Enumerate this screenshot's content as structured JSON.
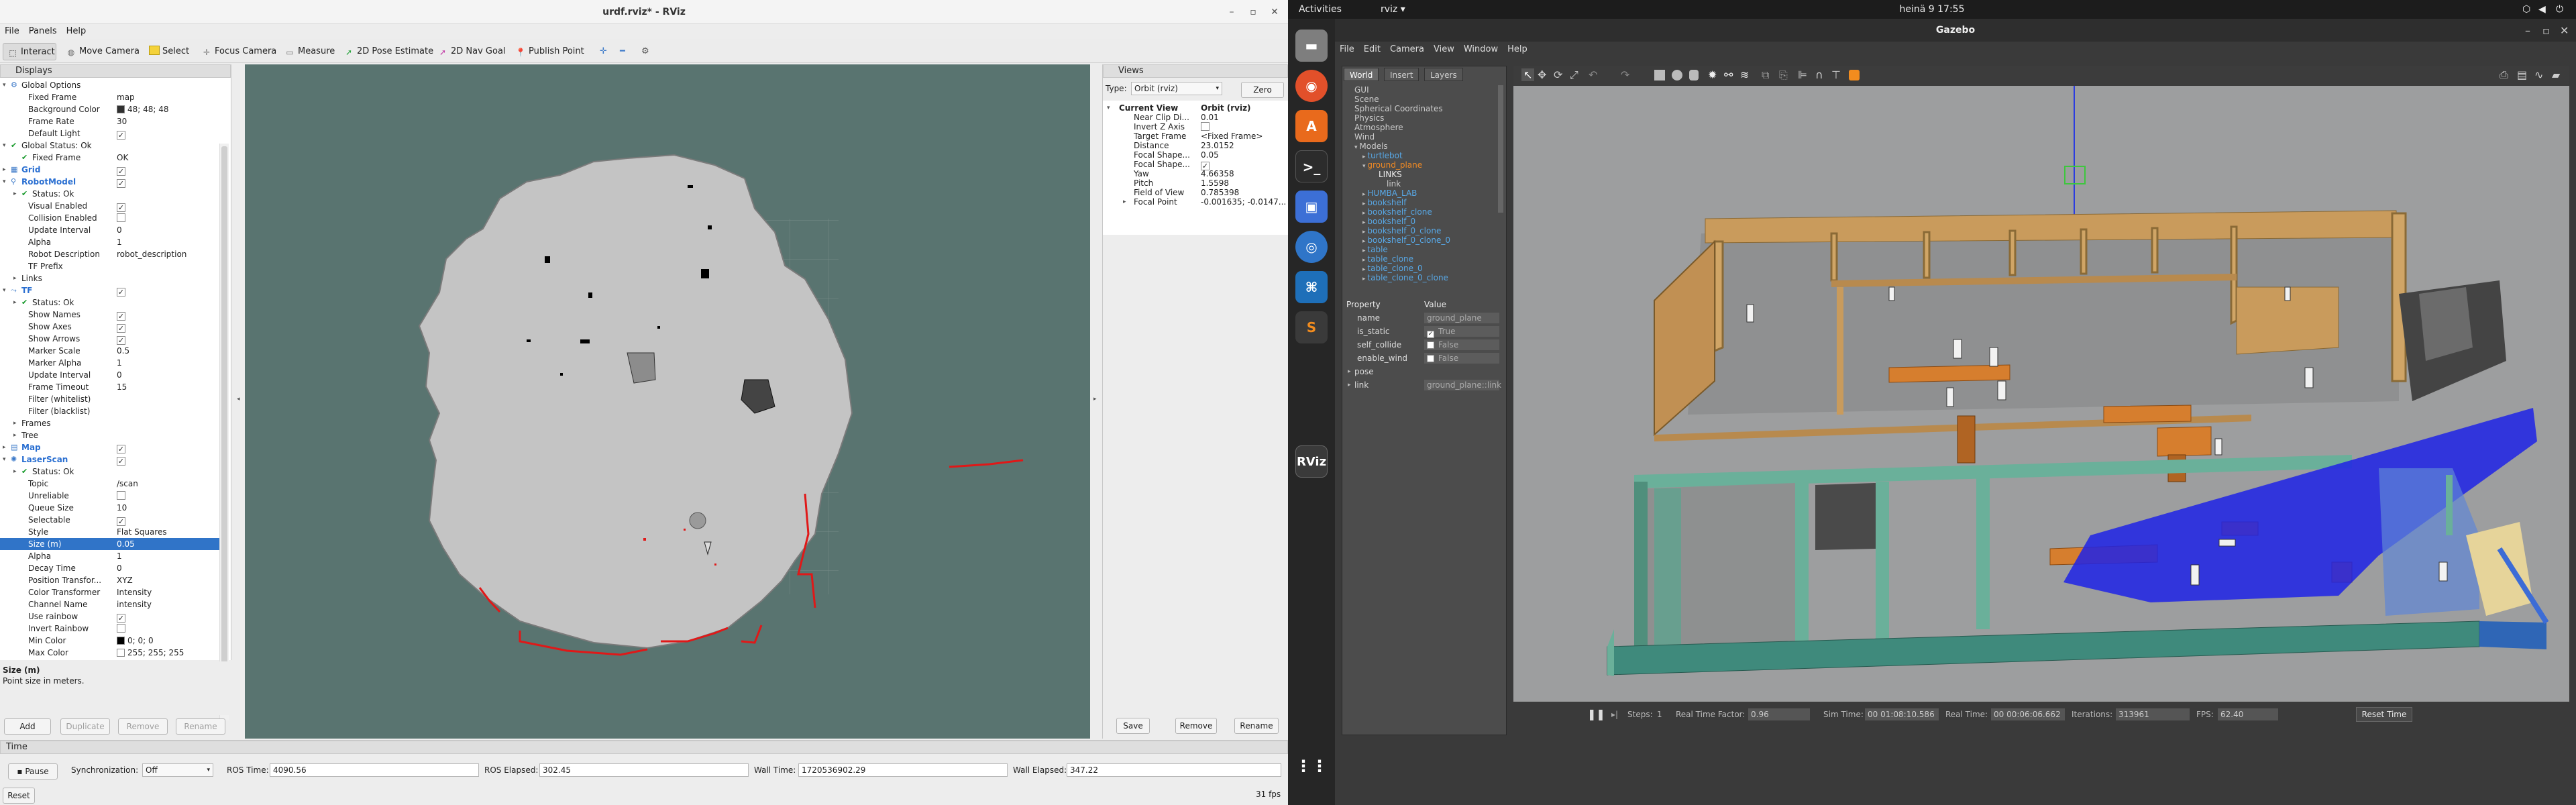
{
  "rviz": {
    "window_title": "urdf.rviz* - RViz",
    "menu": [
      "File",
      "Panels",
      "Help"
    ],
    "tools": [
      "Interact",
      "Move Camera",
      "Select",
      "Focus Camera",
      "Measure",
      "2D Pose Estimate",
      "2D Nav Goal",
      "Publish Point"
    ],
    "displays_title": "Displays",
    "display_rows": [
      {
        "label": "Global Options",
        "value": "",
        "indent": 1,
        "arrow": "▾",
        "icon": "globe",
        "kind": "group"
      },
      {
        "label": "Fixed Frame",
        "value": "map",
        "indent": 2
      },
      {
        "label": "Background Color",
        "value": "48; 48; 48",
        "indent": 2,
        "swatch": "#303030"
      },
      {
        "label": "Frame Rate",
        "value": "30",
        "indent": 2
      },
      {
        "label": "Default Light",
        "value": "",
        "indent": 2,
        "check": true
      },
      {
        "label": "Global Status: Ok",
        "value": "",
        "indent": 1,
        "arrow": "▾",
        "ok": true
      },
      {
        "label": "Fixed Frame",
        "value": "OK",
        "indent": 2,
        "ok": true
      },
      {
        "label": "Grid",
        "value": "",
        "indent": 1,
        "arrow": "▸",
        "blue": true,
        "check": true,
        "icon": "grid"
      },
      {
        "label": "RobotModel",
        "value": "",
        "indent": 1,
        "arrow": "▾",
        "blue": true,
        "check": true,
        "icon": "robot"
      },
      {
        "label": "Status: Ok",
        "value": "",
        "indent": 2,
        "arrow": "▸",
        "ok": true
      },
      {
        "label": "Visual Enabled",
        "value": "",
        "indent": 2,
        "check": true
      },
      {
        "label": "Collision Enabled",
        "value": "",
        "indent": 2,
        "check": false
      },
      {
        "label": "Update Interval",
        "value": "0",
        "indent": 2
      },
      {
        "label": "Alpha",
        "value": "1",
        "indent": 2
      },
      {
        "label": "Robot Description",
        "value": "robot_description",
        "indent": 2
      },
      {
        "label": "TF Prefix",
        "value": "",
        "indent": 2
      },
      {
        "label": "Links",
        "value": "",
        "indent": 2,
        "arrow": "▸"
      },
      {
        "label": "TF",
        "value": "",
        "indent": 1,
        "arrow": "▾",
        "blue": true,
        "check": true,
        "icon": "tf"
      },
      {
        "label": "Status: Ok",
        "value": "",
        "indent": 2,
        "arrow": "▸",
        "ok": true
      },
      {
        "label": "Show Names",
        "value": "",
        "indent": 2,
        "check": true
      },
      {
        "label": "Show Axes",
        "value": "",
        "indent": 2,
        "check": true
      },
      {
        "label": "Show Arrows",
        "value": "",
        "indent": 2,
        "check": true
      },
      {
        "label": "Marker Scale",
        "value": "0.5",
        "indent": 2
      },
      {
        "label": "Marker Alpha",
        "value": "1",
        "indent": 2
      },
      {
        "label": "Update Interval",
        "value": "0",
        "indent": 2
      },
      {
        "label": "Frame Timeout",
        "value": "15",
        "indent": 2
      },
      {
        "label": "Filter (whitelist)",
        "value": "",
        "indent": 2
      },
      {
        "label": "Filter (blacklist)",
        "value": "",
        "indent": 2
      },
      {
        "label": "Frames",
        "value": "",
        "indent": 2,
        "arrow": "▸"
      },
      {
        "label": "Tree",
        "value": "",
        "indent": 2,
        "arrow": "▸"
      },
      {
        "label": "Map",
        "value": "",
        "indent": 1,
        "arrow": "▸",
        "blue": true,
        "check": true,
        "icon": "map"
      },
      {
        "label": "LaserScan",
        "value": "",
        "indent": 1,
        "arrow": "▾",
        "blue": true,
        "check": true,
        "icon": "laser"
      },
      {
        "label": "Status: Ok",
        "value": "",
        "indent": 2,
        "arrow": "▸",
        "ok": true
      },
      {
        "label": "Topic",
        "value": "/scan",
        "indent": 2
      },
      {
        "label": "Unreliable",
        "value": "",
        "indent": 2,
        "check": false
      },
      {
        "label": "Queue Size",
        "value": "10",
        "indent": 2
      },
      {
        "label": "Selectable",
        "value": "",
        "indent": 2,
        "check": true
      },
      {
        "label": "Style",
        "value": "Flat Squares",
        "indent": 2
      },
      {
        "label": "Size (m)",
        "value": "0.05",
        "indent": 2,
        "selected": true
      },
      {
        "label": "Alpha",
        "value": "1",
        "indent": 2
      },
      {
        "label": "Decay Time",
        "value": "0",
        "indent": 2
      },
      {
        "label": "Position Transfor...",
        "value": "XYZ",
        "indent": 2
      },
      {
        "label": "Color Transformer",
        "value": "Intensity",
        "indent": 2
      },
      {
        "label": "Channel Name",
        "value": "intensity",
        "indent": 2
      },
      {
        "label": "Use rainbow",
        "value": "",
        "indent": 2,
        "check": true
      },
      {
        "label": "Invert Rainbow",
        "value": "",
        "indent": 2,
        "check": false
      },
      {
        "label": "Min Color",
        "value": "0; 0; 0",
        "indent": 2,
        "swatch": "#000000"
      },
      {
        "label": "Max Color",
        "value": "255; 255; 255",
        "indent": 2,
        "swatch": "#ffffff"
      }
    ],
    "desc_title": "Size (m)",
    "desc_text": "Point size in meters.",
    "display_buttons": [
      "Add",
      "Duplicate",
      "Remove",
      "Rename"
    ],
    "views_title": "Views",
    "views_type_label": "Type:",
    "views_type_value": "Orbit (rviz)",
    "views_zero": "Zero",
    "view_rows": [
      {
        "label": "Current View",
        "value": "Orbit (rviz)",
        "bold": true,
        "arrow": "▾"
      },
      {
        "label": "Near Clip Di...",
        "value": "0.01"
      },
      {
        "label": "Invert Z Axis",
        "value": "",
        "check": false
      },
      {
        "label": "Target Frame",
        "value": "<Fixed Frame>"
      },
      {
        "label": "Distance",
        "value": "23.0152"
      },
      {
        "label": "Focal Shape...",
        "value": "0.05"
      },
      {
        "label": "Focal Shape...",
        "value": "",
        "check": true
      },
      {
        "label": "Yaw",
        "value": "4.66358"
      },
      {
        "label": "Pitch",
        "value": "1.5598"
      },
      {
        "label": "Field of View",
        "value": "0.785398"
      },
      {
        "label": "Focal Point",
        "value": "-0.001635; -0.0147...",
        "arrow": "▸"
      }
    ],
    "views_buttons": [
      "Save",
      "Remove",
      "Rename"
    ],
    "time_title": "Time",
    "pause": "Pause",
    "sync_label": "Synchronization:",
    "sync_value": "Off",
    "ros_time_label": "ROS Time:",
    "ros_time": "4090.56",
    "ros_elapsed_label": "ROS Elapsed:",
    "ros_elapsed": "302.45",
    "wall_time_label": "Wall Time:",
    "wall_time": "1720536902.29",
    "wall_elapsed_label": "Wall Elapsed:",
    "wall_elapsed": "347.22",
    "reset": "Reset",
    "fps": "31 fps"
  },
  "ubuntu": {
    "activities": "Activities",
    "app_menu": "rviz ▾",
    "clock": "heinä 9  17:55",
    "dock": [
      "files-icon",
      "firefox-icon",
      "software-icon",
      "terminal-icon",
      "screenshot-icon",
      "update-icon",
      "vscode-icon",
      "sublime-icon",
      "rviz-icon"
    ]
  },
  "gazebo": {
    "title": "Gazebo",
    "menu": [
      "File",
      "Edit",
      "Camera",
      "View",
      "Window",
      "Help"
    ],
    "tabs": [
      "World",
      "Insert",
      "Layers"
    ],
    "tree": [
      {
        "t": "GUI",
        "i": 0
      },
      {
        "t": "Scene",
        "i": 0
      },
      {
        "t": "Spherical Coordinates",
        "i": 0
      },
      {
        "t": "Physics",
        "i": 0
      },
      {
        "t": "Atmosphere",
        "i": 0
      },
      {
        "t": "Wind",
        "i": 0
      },
      {
        "t": "Models",
        "i": 0,
        "a": "▾"
      },
      {
        "t": "turtlebot",
        "i": 1,
        "a": "▸",
        "model": true
      },
      {
        "t": "ground_plane",
        "i": 1,
        "a": "▾",
        "sel": true
      },
      {
        "t": "LINKS",
        "i": 3,
        "head": true
      },
      {
        "t": "link",
        "i": 4
      },
      {
        "t": "HUMBA_LAB",
        "i": 1,
        "a": "▸",
        "model": true
      },
      {
        "t": "bookshelf",
        "i": 1,
        "a": "▸",
        "model": true
      },
      {
        "t": "bookshelf_clone",
        "i": 1,
        "a": "▸",
        "model": true
      },
      {
        "t": "bookshelf_0",
        "i": 1,
        "a": "▸",
        "model": true
      },
      {
        "t": "bookshelf_0_clone",
        "i": 1,
        "a": "▸",
        "model": true
      },
      {
        "t": "bookshelf_0_clone_0",
        "i": 1,
        "a": "▸",
        "model": true
      },
      {
        "t": "table",
        "i": 1,
        "a": "▸",
        "model": true
      },
      {
        "t": "table_clone",
        "i": 1,
        "a": "▸",
        "model": true
      },
      {
        "t": "table_clone_0",
        "i": 1,
        "a": "▸",
        "model": true
      },
      {
        "t": "table_clone_0_clone",
        "i": 1,
        "a": "▸",
        "model": true
      }
    ],
    "prop_header": [
      "Property",
      "Value"
    ],
    "props": [
      {
        "k": "name",
        "v": "ground_plane"
      },
      {
        "k": "is_static",
        "v": "True",
        "check": true
      },
      {
        "k": "self_collide",
        "v": "False",
        "check": false
      },
      {
        "k": "enable_wind",
        "v": "False",
        "check": false
      },
      {
        "k": "pose",
        "v": "",
        "arrow": "▸"
      },
      {
        "k": "link",
        "v": "ground_plane::link",
        "arrow": "▸"
      }
    ],
    "steps_label": "Steps:",
    "steps_value": "1",
    "rtf_label": "Real Time Factor:",
    "rtf": "0.96",
    "sim_time_label": "Sim Time:",
    "sim_time": "00 01:08:10.586",
    "real_time_label": "Real Time:",
    "real_time": "00 00:06:06.662",
    "iter_label": "Iterations:",
    "iterations": "313961",
    "fps_label": "FPS:",
    "fps": "62.40",
    "reset_time": "Reset Time"
  }
}
